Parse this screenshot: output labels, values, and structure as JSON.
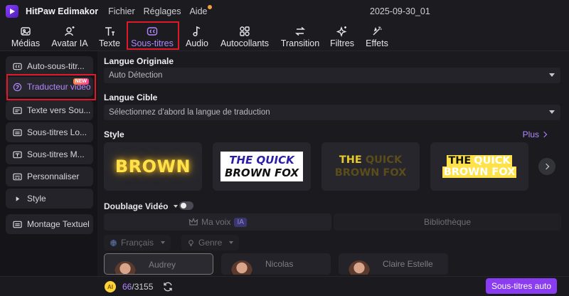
{
  "app": {
    "name": "HitPaw Edimakor",
    "menu": [
      "Fichier",
      "Réglages",
      "Aide"
    ],
    "project": "2025-09-30_01"
  },
  "toolbar": {
    "items": [
      {
        "label": "Médias",
        "icon": "media-icon"
      },
      {
        "label": "Avatar IA",
        "icon": "avatar-ai-icon"
      },
      {
        "label": "Texte",
        "icon": "text-icon"
      },
      {
        "label": "Sous-titres",
        "icon": "subtitles-icon"
      },
      {
        "label": "Audio",
        "icon": "audio-icon"
      },
      {
        "label": "Autocollants",
        "icon": "stickers-icon"
      },
      {
        "label": "Transition",
        "icon": "transition-icon"
      },
      {
        "label": "Filtres",
        "icon": "filters-icon"
      },
      {
        "label": "Effets",
        "icon": "effects-icon"
      }
    ],
    "active": "Sous-titres"
  },
  "sidebar": {
    "items": [
      {
        "label": "Auto-sous-titr...",
        "icon": "cc-icon"
      },
      {
        "label": "Traducteur vidéo",
        "icon": "translate-icon",
        "badge": "NEW"
      },
      {
        "label": "Texte vers Sou...",
        "icon": "text-to-subtitle-icon"
      },
      {
        "label": "Sous-titres Lo...",
        "icon": "local-subtitles-icon"
      },
      {
        "label": "Sous-titres M...",
        "icon": "manual-subtitles-icon"
      },
      {
        "label": "Personnaliser",
        "icon": "customize-icon"
      },
      {
        "label": "Style",
        "icon": "play-triangle-icon"
      },
      {
        "label": "Montage Textuel",
        "icon": "text-edit-icon"
      }
    ],
    "active": "Traducteur vidéo"
  },
  "main": {
    "source_language_title": "Langue Originale",
    "source_language_value": "Auto Détection",
    "target_language_title": "Langue Cible",
    "target_language_placeholder": "Sélectionnez d'abord la langue de traduction",
    "style_title": "Style",
    "more_label": "Plus",
    "styles": [
      {
        "text": "BROWN"
      },
      {
        "line1": "THE QUICK",
        "line2": "BROWN FOX"
      },
      {
        "line1a": "THE",
        "line1b": "QUICK",
        "line2": "BROWN FOX"
      },
      {
        "line1a": "THE",
        "line1b": "QUICK",
        "line2": "BROWN FOX"
      }
    ],
    "dubbing_title": "Doublage Vidéo",
    "dubbing_enabled": false,
    "my_voice_label": "Ma voix",
    "ia_badge": "IA",
    "library_label": "Bibliothèque",
    "filters": {
      "language": "Français",
      "gender": "Genre"
    },
    "voices": [
      "Audrey",
      "Nicolas",
      "Claire Estelle"
    ]
  },
  "footer": {
    "credits_used": "66",
    "credits_total": "/3155",
    "coin_label": "AI",
    "auto_button": "Sous-titres auto"
  },
  "colors": {
    "accent": "#8a3cf0",
    "highlight": "#e0192a",
    "background": "#151519"
  }
}
